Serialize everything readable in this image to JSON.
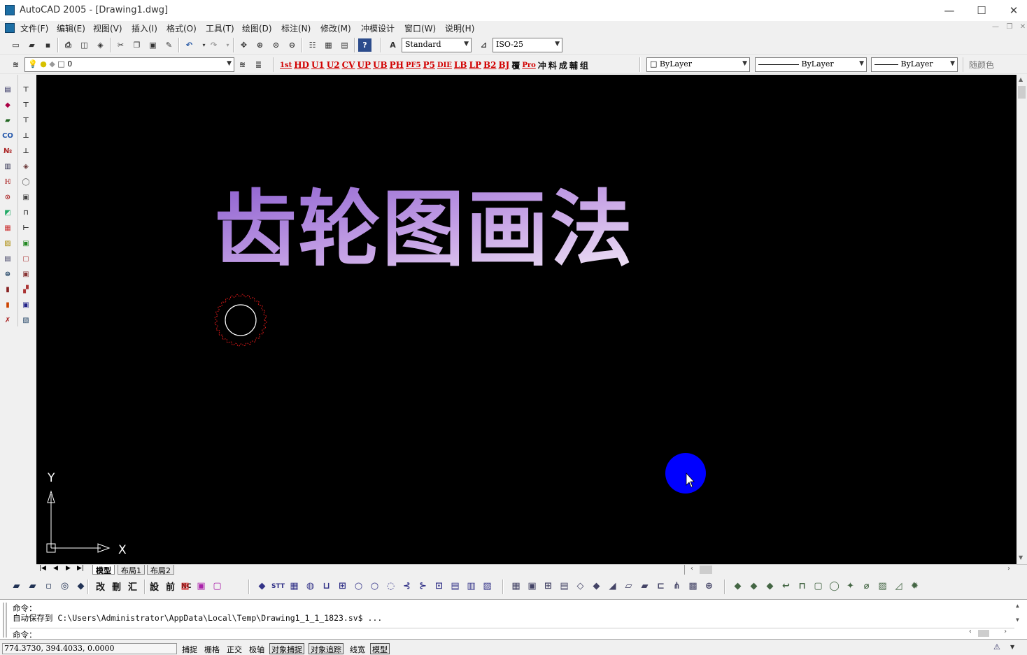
{
  "window": {
    "title": "AutoCAD 2005 - [Drawing1.dwg]",
    "controls": [
      "—",
      "☐",
      "✕"
    ]
  },
  "menu": {
    "items": [
      "文件(F)",
      "编辑(E)",
      "视图(V)",
      "插入(I)",
      "格式(O)",
      "工具(T)",
      "绘图(D)",
      "标注(N)",
      "修改(M)",
      "冲模设计",
      "窗口(W)",
      "说明(H)"
    ],
    "doc_controls": [
      "—",
      "❐",
      "✕"
    ]
  },
  "toolbar1": {
    "text_style": "Standard",
    "dim_style": "ISO-25"
  },
  "toolbar2": {
    "layer": "0",
    "plugin_buttons": [
      "1st",
      "HD",
      "U1",
      "U2",
      "CV",
      "UP",
      "UB",
      "PH",
      "PF5",
      "P5",
      "DIE",
      "LB",
      "LP",
      "B2",
      "BJ",
      "覆",
      "Pro",
      "冲",
      "料",
      "成",
      "輔",
      "组"
    ],
    "color": "ByLayer",
    "linetype": "ByLayer",
    "lineweight": "ByLayer",
    "plot_style": "随颜色"
  },
  "canvas": {
    "heading": "齿轮图画法",
    "ucs_x": "X",
    "ucs_y": "Y"
  },
  "layout_tabs": [
    "模型",
    "布局1",
    "布局2"
  ],
  "drawing_toolbar": {
    "chinese_buttons": [
      "改",
      "刪",
      "汇",
      "設",
      "前",
      "NC"
    ],
    "text_buttons": [
      "STT"
    ]
  },
  "command": {
    "line1": "命令：",
    "line2": "自动保存到 C:\\Users\\Administrator\\AppData\\Local\\Temp\\Drawing1_1_1_1823.sv$ ...",
    "prompt": "命令："
  },
  "status": {
    "coordinates": "774.3730,  394.4033,  0.0000",
    "toggles": [
      {
        "label": "捕捉",
        "on": false
      },
      {
        "label": "栅格",
        "on": false
      },
      {
        "label": "正交",
        "on": false
      },
      {
        "label": "极轴",
        "on": false
      },
      {
        "label": "对象捕捉",
        "on": true
      },
      {
        "label": "对象追踪",
        "on": true
      },
      {
        "label": "线宽",
        "on": false
      },
      {
        "label": "模型",
        "on": true
      }
    ]
  },
  "colors": {
    "canvas_bg": "#000000",
    "title_gradient_from": "#9a6fd6",
    "title_gradient_to": "#e8d8f2",
    "gear_outline": "#d01818",
    "circle_stroke": "#ffffff",
    "cursor_marker": "#0000ff"
  }
}
